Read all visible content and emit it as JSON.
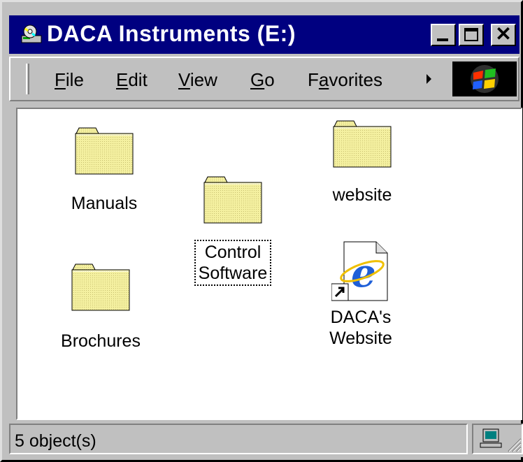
{
  "window": {
    "title": "DACA Instruments (E:)"
  },
  "title_buttons": {
    "minimize": "minimize",
    "maximize": "maximize",
    "close": "✕"
  },
  "menu": [
    {
      "label_prefix": "",
      "label_access": "F",
      "label_rest": "ile"
    },
    {
      "label_prefix": "",
      "label_access": "E",
      "label_rest": "dit"
    },
    {
      "label_prefix": "",
      "label_access": "V",
      "label_rest": "iew"
    },
    {
      "label_prefix": "",
      "label_access": "G",
      "label_rest": "o"
    },
    {
      "label_prefix": "F",
      "label_access": "a",
      "label_rest": "vorites"
    }
  ],
  "items": {
    "manuals": {
      "label": "Manuals",
      "icon": "folder-icon"
    },
    "control_software": {
      "label_line1": "Control",
      "label_line2": "Software",
      "icon": "folder-icon",
      "selected": true
    },
    "website": {
      "label": "website",
      "icon": "folder-icon"
    },
    "brochures": {
      "label": "Brochures",
      "icon": "folder-icon"
    },
    "daca_website": {
      "label_line1": "DACA's",
      "label_line2": "Website",
      "icon": "internet-shortcut-icon"
    }
  },
  "status": {
    "text": "5 object(s)"
  },
  "colors": {
    "titlebar": "#000080",
    "face": "#c0c0c0",
    "desktop": "#008080",
    "folder": "#f4f0a0"
  }
}
